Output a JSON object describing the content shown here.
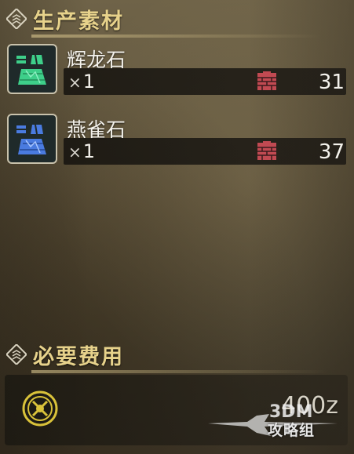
{
  "sections": {
    "materials_title": "生产素材",
    "fee_title": "必要费用"
  },
  "items": [
    {
      "name": "辉龙石",
      "qty_prefix": "×",
      "qty": "1",
      "owned": "31",
      "icon": "green-ore-icon",
      "color": "#3ecf8a"
    },
    {
      "name": "燕雀石",
      "qty_prefix": "×",
      "qty": "1",
      "owned": "37",
      "icon": "blue-ore-icon",
      "color": "#4a7be0"
    }
  ],
  "fee": {
    "amount": "400z",
    "icon": "zenny-coin-icon"
  },
  "watermark": {
    "text": "攻略组",
    "brand": "3DM"
  },
  "colors": {
    "header_gold": "#e7d28b",
    "box_red": "#c14a52"
  }
}
